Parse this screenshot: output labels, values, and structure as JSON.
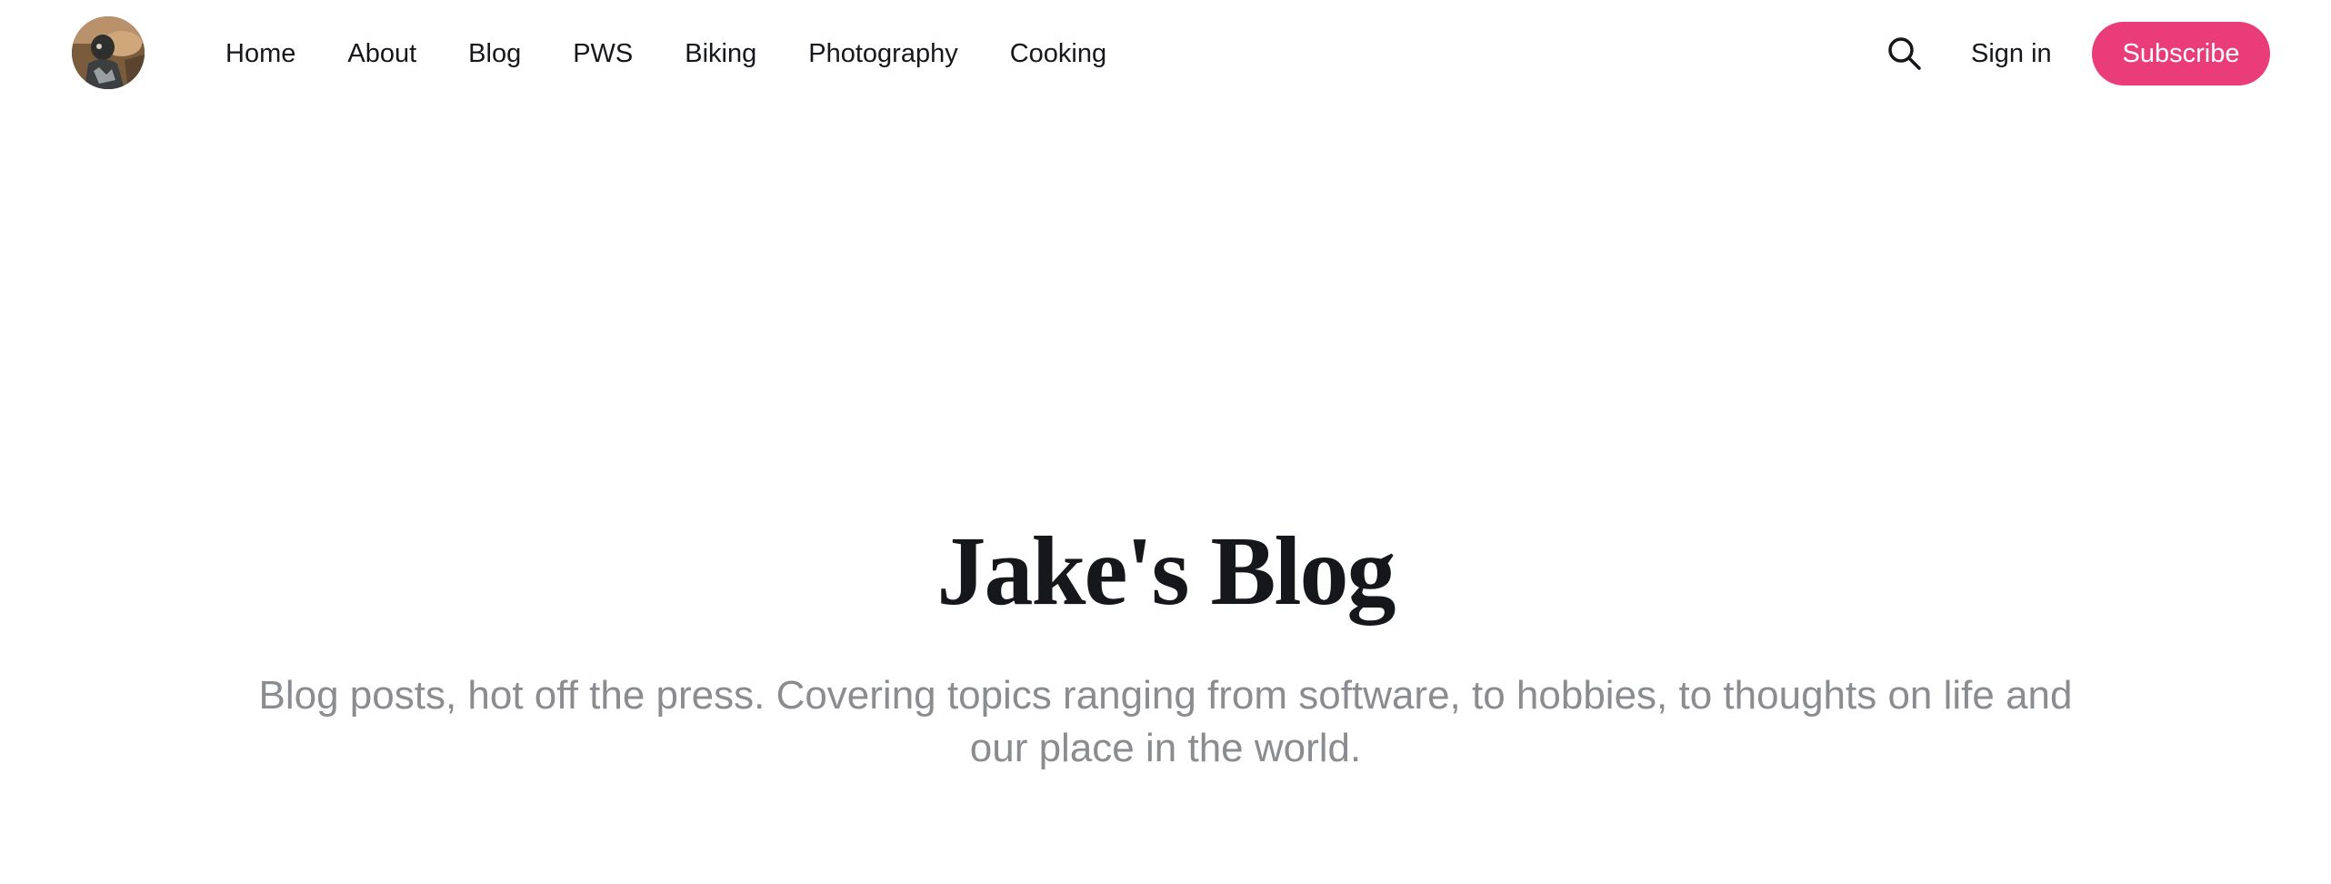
{
  "site": {
    "avatar_alt": "site-avatar",
    "accent_color": "#e93c79"
  },
  "nav": {
    "items": [
      {
        "label": "Home"
      },
      {
        "label": "About"
      },
      {
        "label": "Blog"
      },
      {
        "label": "PWS"
      },
      {
        "label": "Biking"
      },
      {
        "label": "Photography"
      },
      {
        "label": "Cooking"
      }
    ]
  },
  "actions": {
    "search_icon": "search-icon",
    "signin_label": "Sign in",
    "subscribe_label": "Subscribe"
  },
  "hero": {
    "title": "Jake's Blog",
    "description": "Blog posts, hot off the press. Covering topics ranging from software, to hobbies, to thoughts on life and our place in the world."
  }
}
